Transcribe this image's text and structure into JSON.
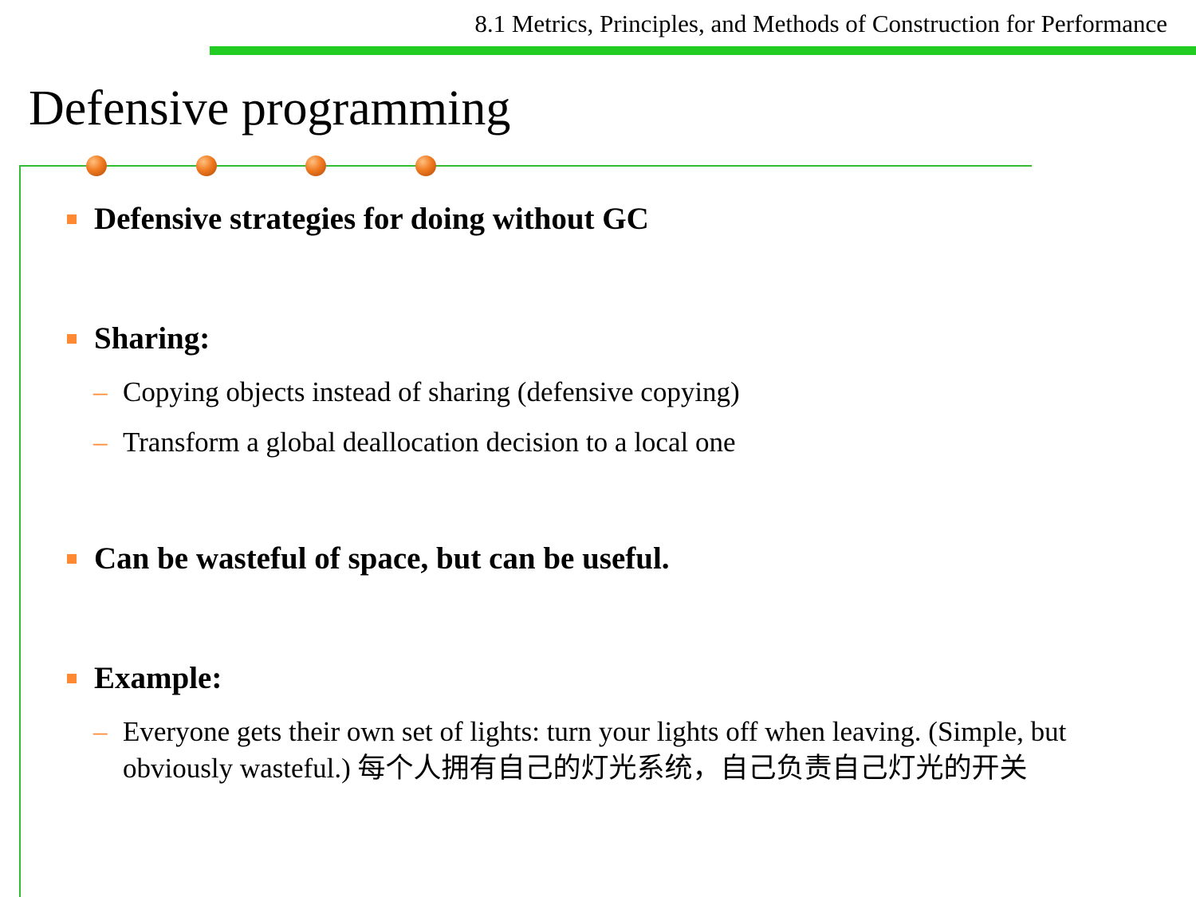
{
  "header": {
    "section_title": "8.1 Metrics, Principles, and Methods of Construction for Performance"
  },
  "slide": {
    "title": "Defensive programming"
  },
  "bullets": [
    {
      "text": "Defensive strategies for doing without GC"
    },
    {
      "text": "Sharing:"
    },
    {
      "text": "Can be wasteful of space, but can be useful."
    },
    {
      "text": "Example:"
    }
  ],
  "sub_bullets": {
    "sharing": [
      "Copying objects instead of sharing (defensive copying)",
      "Transform a global deallocation decision to a local one"
    ],
    "example": [
      "Everyone gets their own set of lights: turn your lights off when leaving. (Simple, but obviously wasteful.) 每个人拥有自己的灯光系统，自己负责自己灯光的开关"
    ]
  },
  "colors": {
    "header_rule": "#22cc22",
    "frame_line": "#33bb33",
    "bullet_accent": "#ff8a33",
    "dot_orange": "#f07a20"
  }
}
